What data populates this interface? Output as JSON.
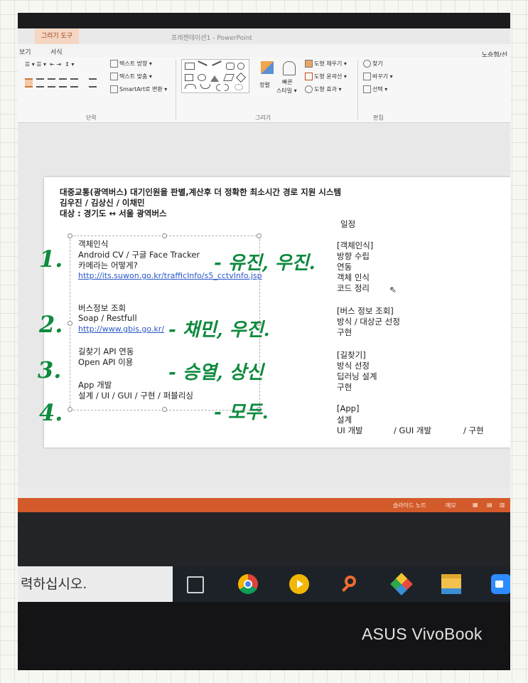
{
  "window": {
    "contextual_tab": "그리기 도구",
    "title": "프레젠테이션1 - PowerPoint",
    "user": "노승협/선",
    "menu": [
      "보기",
      "서식"
    ]
  },
  "ribbon": {
    "paragraph": {
      "text_direction": "텍스트 방향 ▾",
      "align_text": "텍스트 맞춤 ▾",
      "smartart": "SmartArt로 변환 ▾",
      "group_label": "단락"
    },
    "drawing": {
      "arrange": "정렬",
      "quick_styles_1": "빠른",
      "quick_styles_2": "스타일 ▾",
      "shape_fill": "도형 채우기 ▾",
      "shape_outline": "도형 윤곽선 ▾",
      "shape_effects": "도형 효과 ▾",
      "group_label": "그리기"
    },
    "editing": {
      "find": "찾기",
      "replace": "바꾸기 ▾",
      "select": "선택 ▾",
      "group_label": "편집"
    }
  },
  "slide": {
    "title": "대중교통(광역버스) 대기인원을 판별,계산후 더 정확한 최소시간 경로 지원 시스템",
    "members": "김우진 / 김상신 / 이채민",
    "target": "대상 : 경기도 ↔ 서울 광역버스",
    "sections": [
      {
        "lines": [
          "객체인식",
          "Android CV / 구글 Face Tracker",
          "카메라는 어떻게?"
        ],
        "link": "http://its.suwon.go.kr/trafficInfo/s5_cctvInfo.jsp"
      },
      {
        "lines": [
          "버스정보 조회",
          "Soap / Restfull"
        ],
        "link": "http://www.gbis.go.kr/"
      },
      {
        "lines": [
          "길찾기 API 연동",
          "Open API 이용"
        ],
        "link": ""
      },
      {
        "lines": [
          "App 개발",
          "설계 / UI / GUI / 구현 / 퍼블리싱"
        ],
        "link": ""
      }
    ],
    "schedule": {
      "heading": "일정",
      "blocks": [
        [
          "[객체인식]",
          "방향 수립",
          "연동",
          "객체 인식",
          "코드 정리"
        ],
        [
          "[버스 정보 조회]",
          "방식 / 대상군 선정",
          "구현"
        ],
        [
          "[길찾기]",
          "방식 선정",
          "딥러닝 설계",
          "구현"
        ],
        [
          "[App]",
          "설계"
        ]
      ],
      "last_row": [
        "UI 개발",
        "/ GUI 개발",
        "/ 구현"
      ]
    }
  },
  "handwriting": {
    "numbers": [
      "1.",
      "2.",
      "3.",
      "4."
    ],
    "names": [
      "- 유진, 우진.",
      "- 채민, 우진.",
      "- 승열, 상신",
      "- 모두."
    ],
    "ink_color": "#0e8a3e"
  },
  "statusbar": {
    "notes": "슬라이드 노트",
    "comments": "메모"
  },
  "taskbar": {
    "search_text": "력하십시오.",
    "icons": [
      "task-view-icon",
      "chrome-icon",
      "media-player-icon",
      "search-app-icon",
      "photos-icon",
      "file-explorer-icon",
      "zoom-icon"
    ]
  },
  "laptop": {
    "brand": "ASUS VivoBook"
  }
}
